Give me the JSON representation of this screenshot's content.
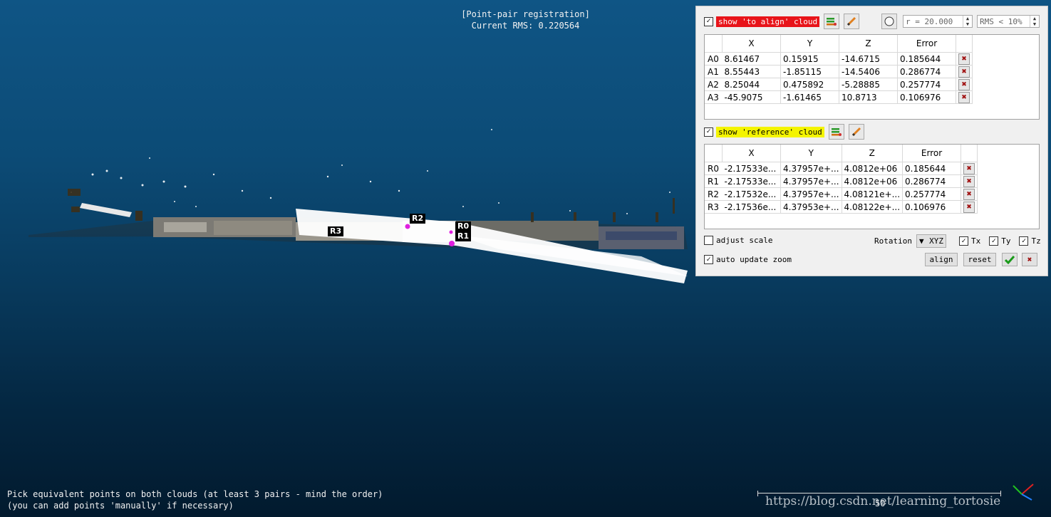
{
  "overlay": {
    "title_line1": "[Point-pair registration]",
    "title_line2": "Current RMS: 0.220564",
    "hint_line1": "Pick equivalent points on both clouds (at least 3 pairs - mind the order)",
    "hint_line2": "(you can add points 'manually' if necessary)",
    "scale_value": "50",
    "watermark": "https://blog.csdn.net/learning_tortosie"
  },
  "point_labels": [
    "R2",
    "R0",
    "R1",
    "R3"
  ],
  "to_align": {
    "show_label": "show 'to align' cloud",
    "checked": true,
    "radius": "r = 20.000",
    "rms_filter": "RMS < 10%",
    "columns": [
      "X",
      "Y",
      "Z",
      "Error"
    ],
    "rows": [
      {
        "id": "A0",
        "x": "8.61467",
        "y": "0.15915",
        "z": "-14.6715",
        "error": "0.185644"
      },
      {
        "id": "A1",
        "x": "8.55443",
        "y": "-1.85115",
        "z": "-14.5406",
        "error": "0.286774"
      },
      {
        "id": "A2",
        "x": "8.25044",
        "y": "0.475892",
        "z": "-5.28885",
        "error": "0.257774"
      },
      {
        "id": "A3",
        "x": "-45.9075",
        "y": "-1.61465",
        "z": "10.8713",
        "error": "0.106976"
      }
    ]
  },
  "reference": {
    "show_label": "show 'reference' cloud",
    "checked": true,
    "columns": [
      "X",
      "Y",
      "Z",
      "Error"
    ],
    "rows": [
      {
        "id": "R0",
        "x": "-2.17533e...",
        "y": "4.37957e+...",
        "z": "4.0812e+06",
        "error": "0.185644"
      },
      {
        "id": "R1",
        "x": "-2.17533e...",
        "y": "4.37957e+...",
        "z": "4.0812e+06",
        "error": "0.286774"
      },
      {
        "id": "R2",
        "x": "-2.17532e...",
        "y": "4.37957e+...",
        "z": "4.08121e+...",
        "error": "0.257774"
      },
      {
        "id": "R3",
        "x": "-2.17536e...",
        "y": "4.37953e+...",
        "z": "4.08122e+...",
        "error": "0.106976"
      }
    ]
  },
  "options": {
    "adjust_scale": "adjust scale",
    "adjust_scale_checked": false,
    "rotation_label": "Rotation",
    "rotation_value": "XYZ",
    "tx": "Tx",
    "ty": "Ty",
    "tz": "Tz",
    "auto_update_zoom": "auto update zoom",
    "auto_update_zoom_checked": true,
    "align_button": "align",
    "reset_button": "reset"
  }
}
